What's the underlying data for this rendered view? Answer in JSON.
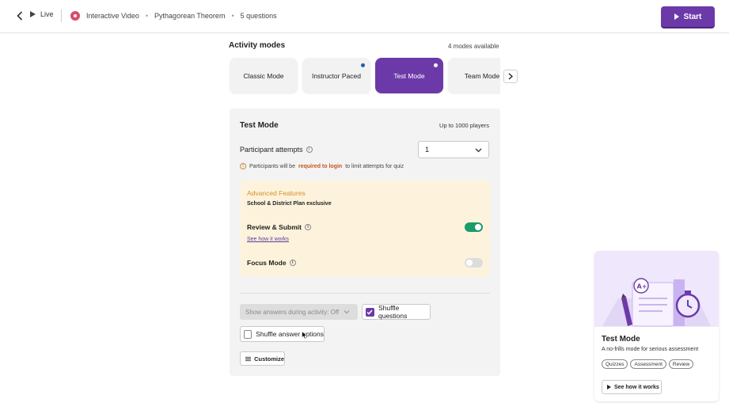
{
  "header": {
    "live_label": "Live",
    "breadcrumb": [
      "Interactive Video",
      "Pythagorean Theorem",
      "5 questions"
    ],
    "start_label": "Start"
  },
  "activity_modes": {
    "title": "Activity modes",
    "count_label": "4 modes available",
    "modes": [
      {
        "label": "Classic Mode",
        "active": false,
        "indicator": false
      },
      {
        "label": "Instructor Paced",
        "active": false,
        "indicator": true
      },
      {
        "label": "Test Mode",
        "active": true,
        "indicator": true
      },
      {
        "label": "Team Mode",
        "active": false,
        "indicator": false
      }
    ]
  },
  "panel": {
    "title": "Test Mode",
    "players": "Up to 1000 players",
    "attempts_label": "Participant attempts",
    "attempts_value": "1",
    "login_note_prefix": "Participants will be",
    "login_note_link": "required to login",
    "login_note_suffix": "to limit attempts for quiz",
    "advanced": {
      "title": "Advanced Features",
      "subtitle": "School & District Plan exclusive",
      "review_submit_label": "Review & Submit",
      "review_submit_on": true,
      "see_how_link": "See how it works",
      "focus_mode_label": "Focus Mode",
      "focus_mode_on": false
    },
    "show_answers_label": "Show answers during activity: Off",
    "shuffle_questions_label": "Shuffle questions",
    "shuffle_questions_checked": true,
    "shuffle_answers_label": "Shuffle answer options",
    "shuffle_answers_checked": false,
    "customize_label": "Customize"
  },
  "info_card": {
    "title": "Test Mode",
    "description": "A no-frills mode for serious assessment",
    "tags": [
      "Quizzes",
      "Assessment",
      "Review"
    ],
    "button_label": "See how it works"
  },
  "colors": {
    "accent": "#6c3aa8",
    "toggle_on": "#1a9b6a",
    "advanced_bg": "#fdf3dc",
    "advanced_title": "#d9902a",
    "link_warning": "#c4561e",
    "indicator_blue": "#1f5fa8"
  }
}
